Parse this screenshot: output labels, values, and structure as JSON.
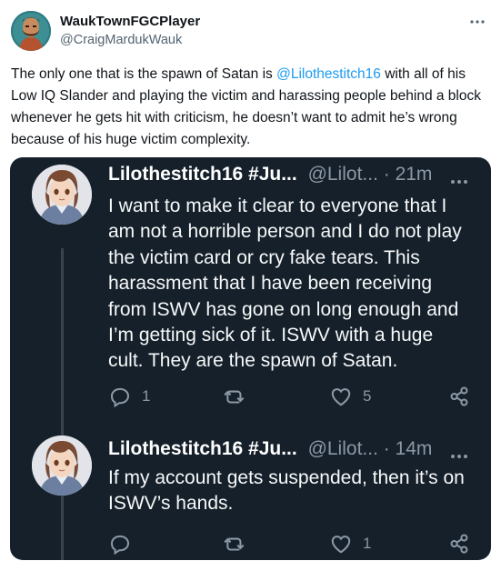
{
  "post": {
    "author_name": "WaukTownFGCPlayer",
    "author_handle": "@CraigMardukWauk",
    "text_before_mention": "The only one that is the spawn of Satan is ",
    "mention": "@Lilothestitch16",
    "text_after_mention": " with all of his Low IQ Slander and playing the victim and harassing people behind a block whenever he gets hit with criticism, he doesn’t want to admit he’s wrong because of his huge victim complexity.",
    "more_icon": "more-horizontal-icon"
  },
  "embedded_thread": {
    "background": "#15202b",
    "tweets": [
      {
        "name": "Lilothestitch16 #Ju...",
        "handle_time": "@Lilot... · 21m",
        "text": "I want to make it clear to everyone that I am not a horrible person and I do not play the victim card or cry fake tears. This harassment that I have been receiving from ISWV has gone on long enough and I’m getting sick of it. ISWV with a huge cult. They are the spawn of Satan.",
        "reply_count": "1",
        "retweet_count": "",
        "like_count": "5"
      },
      {
        "name": "Lilothestitch16 #Ju...",
        "handle_time": "@Lilot... · 14m",
        "text": "If my account gets suspended, then it’s on ISWV’s hands.",
        "reply_count": "",
        "retweet_count": "",
        "like_count": "1"
      }
    ]
  },
  "colors": {
    "accent": "#1d9bf0",
    "secondary_text": "#536471",
    "dark_secondary": "#8b98a5"
  }
}
